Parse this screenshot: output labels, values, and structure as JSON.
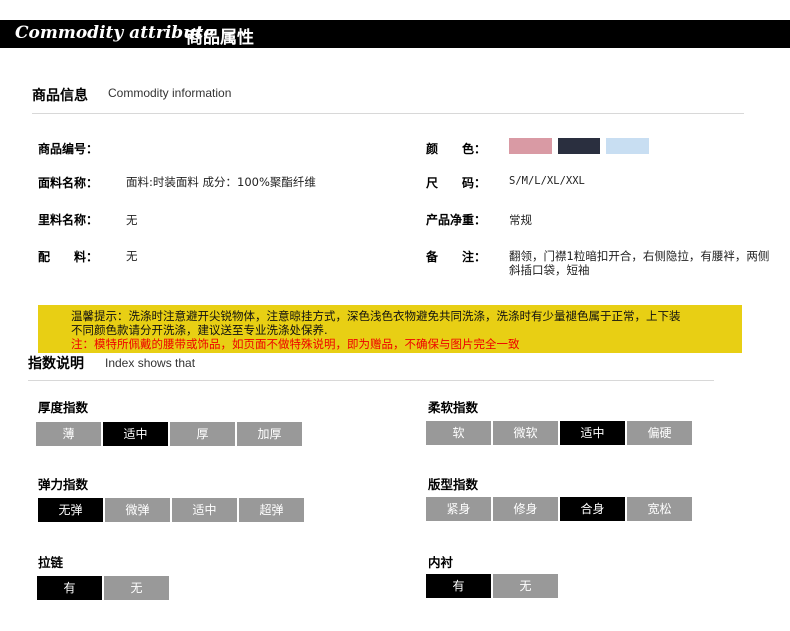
{
  "banner": {
    "title_en": "Commodity attribute",
    "title_cn": "商品属性"
  },
  "info": {
    "title": "商品信息",
    "subtitle": "Commodity information"
  },
  "fields": {
    "item_no": {
      "label": "商品编号：",
      "value": ""
    },
    "fabric": {
      "label": "面料名称：",
      "value": "面料:时装面料 成分：100%聚酯纤维"
    },
    "lining": {
      "label": "里料名称：",
      "value": "无"
    },
    "accessory": {
      "label": "配　　料：",
      "value": "无"
    },
    "color": {
      "label": "颜　　色：",
      "swatches": [
        "#d99aa4",
        "#2a2f3f",
        "#c8def2"
      ]
    },
    "size": {
      "label": "尺　　码：",
      "value": "S/M/L/XL/XXL"
    },
    "weight": {
      "label": "产品净重：",
      "value": "常规"
    },
    "note": {
      "label": "备　　注：",
      "value_line1": "翻领，门襟1粒暗扣开合，右侧隐拉，有腰袢，两侧",
      "value_line2": "斜插口袋，短袖"
    }
  },
  "notice": {
    "line1": "温馨提示：洗涤时注意避开尖锐物体，注意晾挂方式，深色浅色衣物避免共同洗涤，洗涤时有少量褪色属于正常，上下装",
    "line2": "不同颜色款请分开洗涤，建议送至专业洗涤处保养.",
    "line3": "注：模特所佩戴的腰带或饰品，如页面不做特殊说明，即为赠品，不确保与图片完全一致",
    "line3_color": "#ee0000"
  },
  "index": {
    "title": "指数说明",
    "subtitle": "Index shows that"
  },
  "indices": {
    "thickness": {
      "title": "厚度指数",
      "options": [
        "薄",
        "适中",
        "厚",
        "加厚"
      ],
      "selected": 1
    },
    "softness": {
      "title": "柔软指数",
      "options": [
        "软",
        "微软",
        "适中",
        "偏硬"
      ],
      "selected": 2
    },
    "elastic": {
      "title": "弹力指数",
      "options": [
        "无弹",
        "微弹",
        "适中",
        "超弹"
      ],
      "selected": 0
    },
    "fit": {
      "title": "版型指数",
      "options": [
        "紧身",
        "修身",
        "合身",
        "宽松"
      ],
      "selected": 2
    },
    "zipper": {
      "title": "拉链",
      "options": [
        "有",
        "无"
      ],
      "selected": 0
    },
    "inner": {
      "title": "内衬",
      "options": [
        "有",
        "无"
      ],
      "selected": 0
    }
  },
  "colors": {
    "selected": "#000000",
    "unselected": "#999999",
    "notice_bg": "#e8cf14"
  }
}
